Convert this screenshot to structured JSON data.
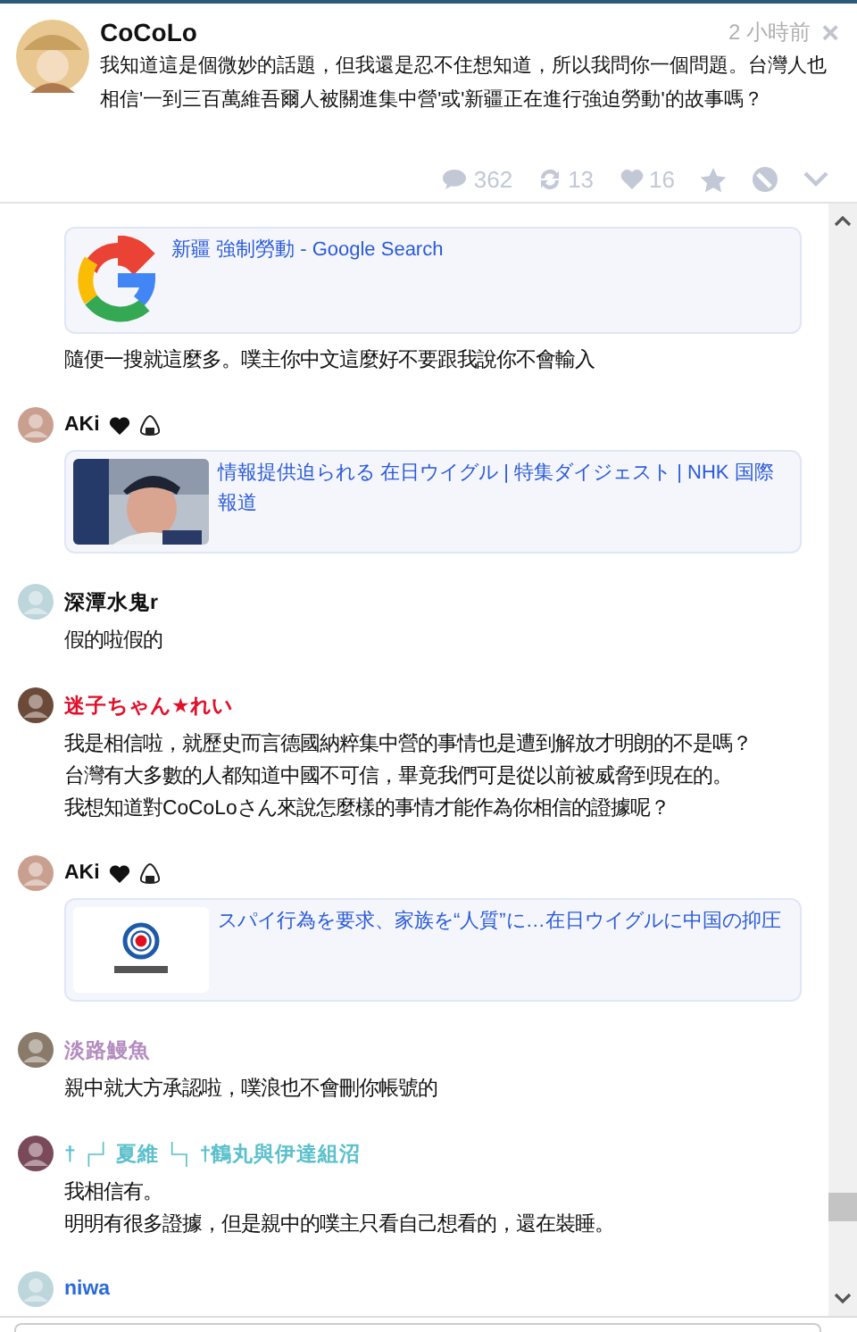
{
  "post": {
    "author": "CoCoLo",
    "time": "2 小時前",
    "close": "×",
    "text": "我知道這是個微妙的話題，但我還是忍不住想知道，所以我問你一個問題。台灣人也相信'一到三百萬維吾爾人被關進集中營'或'新疆正在進行強迫勞動'的故事嗎？",
    "stats": [
      {
        "kind": "responses",
        "count": "362"
      },
      {
        "kind": "replurks",
        "count": "13"
      },
      {
        "kind": "likes",
        "count": "16"
      }
    ]
  },
  "responses": [
    {
      "link": {
        "kind": "google",
        "title": "新疆 強制勞動 - Google Search"
      },
      "lines": [
        "隨便一搜就這麼多。噗主你中文這麼好不要跟我說你不會輸入"
      ]
    },
    {
      "author": "AKi",
      "color": "#111111",
      "badges": [
        {
          "kind": "heart"
        },
        {
          "kind": "riceball"
        }
      ],
      "link": {
        "kind": "picture",
        "title": "情報提供迫られる 在日ウイグル | 特集ダイジェスト | NHK 国際報道"
      }
    },
    {
      "author": "深潭水鬼r",
      "color": "#111111",
      "lines": [
        "假的啦假的"
      ]
    },
    {
      "author": "迷子ちゃん★れい",
      "color": "#e0102a",
      "lines": [
        "我是相信啦，就歷史而言德國納粹集中營的事情也是遭到解放才明朗的不是嗎？",
        "台灣有大多數的人都知道中國不可信，畢竟我們可是從以前被威脅到現在的。",
        "我想知道對CoCoLoさん來說怎麼樣的事情才能作為你相信的證據呢？"
      ]
    },
    {
      "author": "AKi",
      "color": "#111111",
      "badges": [
        {
          "kind": "heart"
        },
        {
          "kind": "riceball"
        }
      ],
      "link": {
        "kind": "logo",
        "title": "スパイ行為を要求、家族を“人質”に…在日ウイグルに中国の抑圧"
      }
    },
    {
      "author": "淡路鰻魚",
      "color": "#b48bc0",
      "lines": [
        "親中就大方承認啦，噗浪也不會刪你帳號的"
      ]
    },
    {
      "author": "† ┌┘ 夏維 └┐ †鶴丸與伊達組沼",
      "color": "#5bc0cc",
      "lines": [
        "我相信有。",
        "明明有很多證據，但是親中的噗主只看自己想看的，還在裝睡。"
      ]
    },
    {
      "author": "niwa",
      "color": "#2a6ad8"
    }
  ]
}
